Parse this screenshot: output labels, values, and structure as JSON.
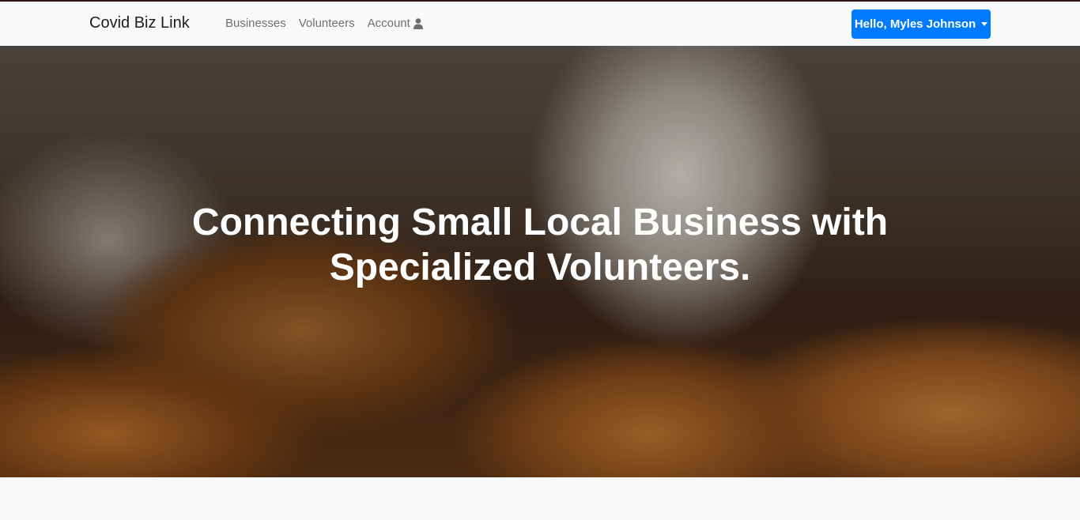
{
  "navbar": {
    "brand": "Covid Biz Link",
    "links": [
      {
        "label": "Businesses"
      },
      {
        "label": "Volunteers"
      },
      {
        "label": "Account",
        "icon": "user-icon"
      }
    ],
    "user_menu_label": "Hello, Myles Johnson"
  },
  "hero": {
    "title_line1": "Connecting Small Local Business with",
    "title_line2": "Specialized Volunteers."
  },
  "colors": {
    "accent": "#007bff",
    "navbar_bg": "#f8f9fa"
  }
}
